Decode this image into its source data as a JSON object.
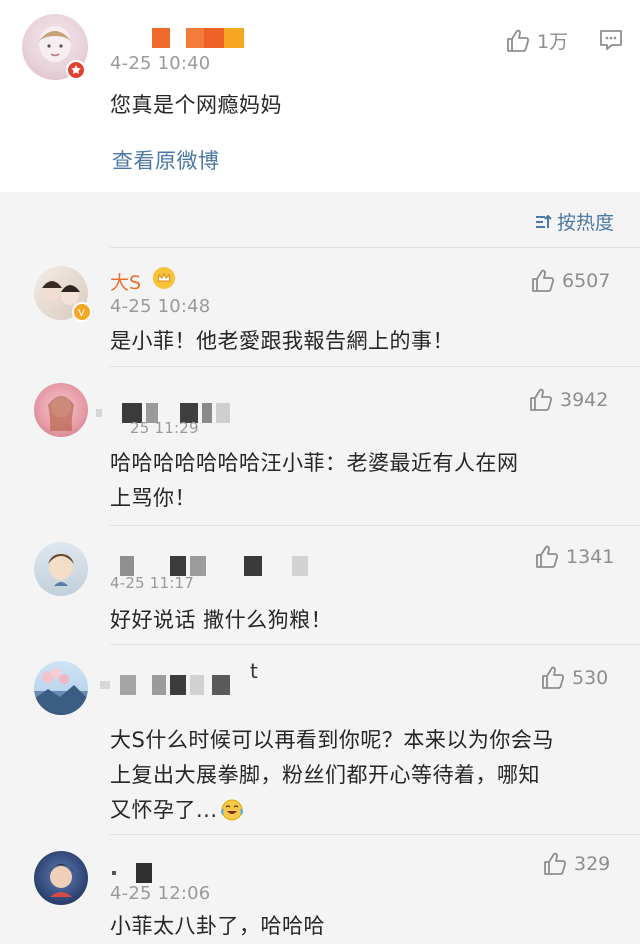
{
  "post": {
    "time": "4-25 10:40",
    "text": "您真是个网瘾妈妈",
    "view_original": "查看原微博",
    "like_count": "1万"
  },
  "sort": {
    "label": "按热度"
  },
  "comments": [
    {
      "name": "大S",
      "time": "4-25 10:48",
      "text_lines": [
        "是小菲！他老愛跟我報告網上的事！"
      ],
      "likes": "6507"
    },
    {
      "time": "25 11:29",
      "text_lines": [
        "哈哈哈哈哈哈哈汪小菲：老婆最近有人在网",
        "上骂你！"
      ],
      "likes": "3942"
    },
    {
      "time": "4-25 11:17",
      "text_lines": [
        "好好说话 撒什么狗粮！"
      ],
      "likes": "1341"
    },
    {
      "name_suffix": "t",
      "text_lines": [
        "大S什么时候可以再看到你呢？本来以为你会马",
        "上复出大展拳脚，粉丝们都开心等待着，哪知",
        "又怀孕了..."
      ],
      "likes": "530"
    },
    {
      "time": "4-25 12:06",
      "text_lines": [
        "小菲太八卦了，哈哈哈"
      ],
      "likes": "329"
    }
  ],
  "colors": {
    "link": "#4c78a6",
    "vip_name": "#e8722c",
    "meta": "#9a9a9a",
    "background": "#f4f4f4"
  }
}
